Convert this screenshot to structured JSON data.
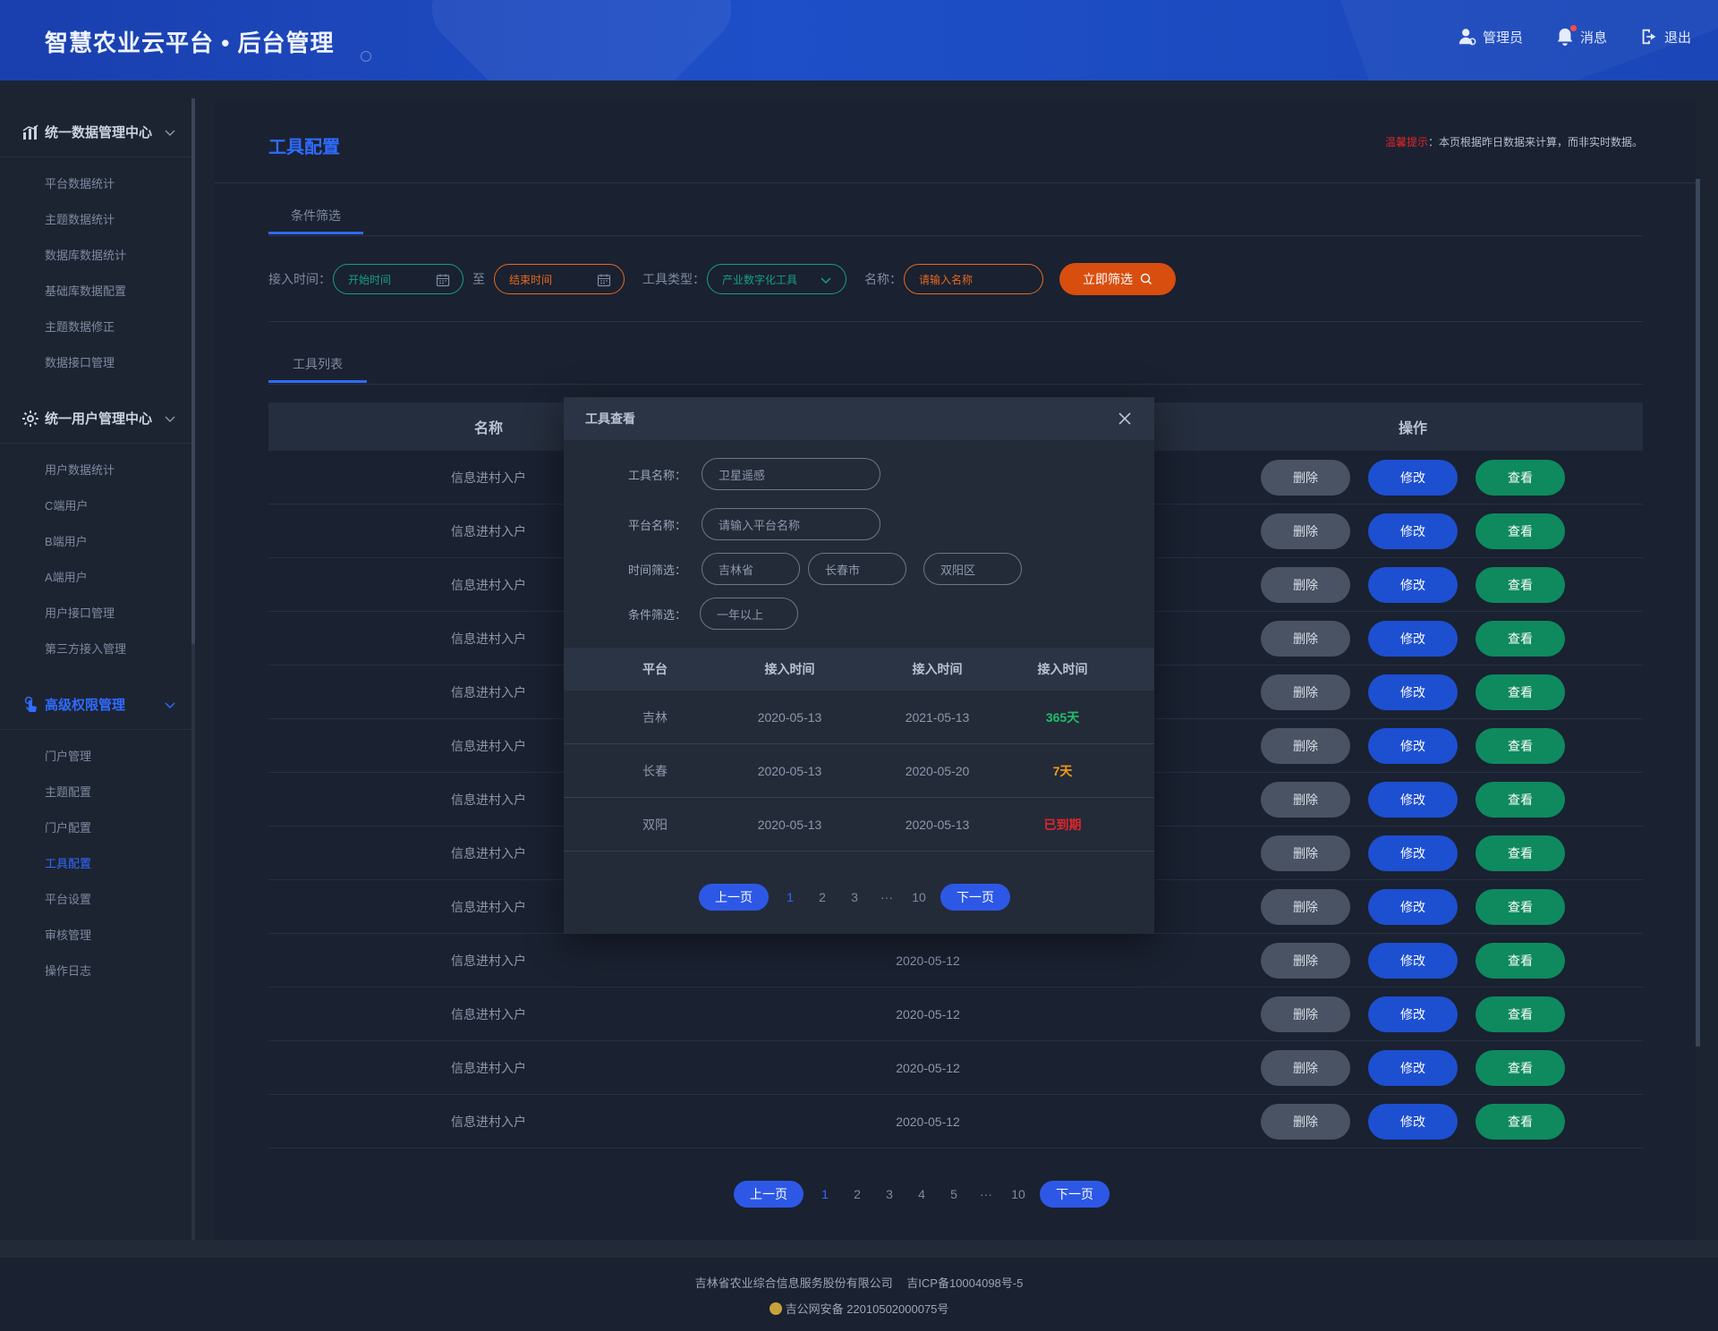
{
  "header": {
    "title": "智慧农业云平台 • 后台管理",
    "actions": [
      {
        "label": "管理员",
        "icon": "user-icon"
      },
      {
        "label": "消息",
        "icon": "bell-icon"
      },
      {
        "label": "退出",
        "icon": "logout-icon"
      }
    ]
  },
  "sidebar": {
    "groups": [
      {
        "title": "统一数据管理中心",
        "icon": "chart-icon",
        "items": [
          "平台数据统计",
          "主题数据统计",
          "数据库数据统计",
          "基础库数据配置",
          "主题数据修正",
          "数据接口管理"
        ]
      },
      {
        "title": "统一用户管理中心",
        "icon": "gear-icon",
        "items": [
          "用户数据统计",
          "C端用户",
          "B端用户",
          "A端用户",
          "用户接口管理",
          "第三方接入管理"
        ]
      },
      {
        "title": "高级权限管理",
        "icon": "touch-icon",
        "items": [
          "门户管理",
          "主题配置",
          "门户配置",
          "工具配置",
          "平台设置",
          "审核管理",
          "操作日志"
        ]
      }
    ],
    "active_item": "工具配置"
  },
  "main": {
    "title": "工具配置",
    "notice_prefix": "温馨提示",
    "notice_text": "：本页根据昨日数据来计算，而非实时数据。",
    "filter_tab": "条件筛选",
    "filters": {
      "time_label": "接入时间：",
      "start_placeholder": "开始时间",
      "to": "至",
      "end_placeholder": "结束时间",
      "type_label": "工具类型：",
      "type_value": "产业数字化工具",
      "name_label": "名称：",
      "name_placeholder": "请输入名称",
      "submit": "立即筛选"
    },
    "list_tab": "工具列表",
    "table": {
      "headers": [
        "名称",
        "",
        "操作"
      ],
      "rows": [
        {
          "name": "信息进村入户",
          "date": ""
        },
        {
          "name": "信息进村入户",
          "date": ""
        },
        {
          "name": "信息进村入户",
          "date": ""
        },
        {
          "name": "信息进村入户",
          "date": ""
        },
        {
          "name": "信息进村入户",
          "date": ""
        },
        {
          "name": "信息进村入户",
          "date": ""
        },
        {
          "name": "信息进村入户",
          "date": ""
        },
        {
          "name": "信息进村入户",
          "date": ""
        },
        {
          "name": "信息进村入户",
          "date": ""
        },
        {
          "name": "信息进村入户",
          "date": "2020-05-12"
        },
        {
          "name": "信息进村入户",
          "date": "2020-05-12"
        },
        {
          "name": "信息进村入户",
          "date": "2020-05-12"
        },
        {
          "name": "信息进村入户",
          "date": "2020-05-12"
        }
      ],
      "actions": {
        "delete": "删除",
        "edit": "修改",
        "view": "查看"
      }
    },
    "pagination": {
      "prev": "上一页",
      "next": "下一页",
      "pages": [
        "1",
        "2",
        "3",
        "4",
        "5",
        "···",
        "10"
      ],
      "current": "1"
    }
  },
  "modal": {
    "title": "工具查看",
    "fields": {
      "tool_name_label": "工具名称：",
      "tool_name_value": "卫星遥感",
      "platform_label": "平台名称：",
      "platform_placeholder": "请输入平台名称",
      "time_label": "时间筛选：",
      "province": "吉林省",
      "city": "长春市",
      "district": "双阳区",
      "cond_label": "条件筛选：",
      "cond_value": "一年以上"
    },
    "table": {
      "headers": [
        "平台",
        "接入时间",
        "接入时间",
        "接入时间"
      ],
      "rows": [
        {
          "platform": "吉林",
          "t1": "2020-05-13",
          "t2": "2021-05-13",
          "status": "365天",
          "status_color": "#1fbf6a"
        },
        {
          "platform": "长春",
          "t1": "2020-05-13",
          "t2": "2020-05-20",
          "status": "7天",
          "status_color": "#f39c12"
        },
        {
          "platform": "双阳",
          "t1": "2020-05-13",
          "t2": "2020-05-13",
          "status": "已到期",
          "status_color": "#e0262c"
        }
      ]
    },
    "pagination": {
      "prev": "上一页",
      "next": "下一页",
      "pages": [
        "1",
        "2",
        "3",
        "···",
        "10"
      ],
      "current": "1"
    }
  },
  "footer": {
    "company": "吉林省农业综合信息服务股份有限公司",
    "icp": "吉ICP备10004098号-5",
    "police": "吉公网安备 22010502000075号"
  }
}
